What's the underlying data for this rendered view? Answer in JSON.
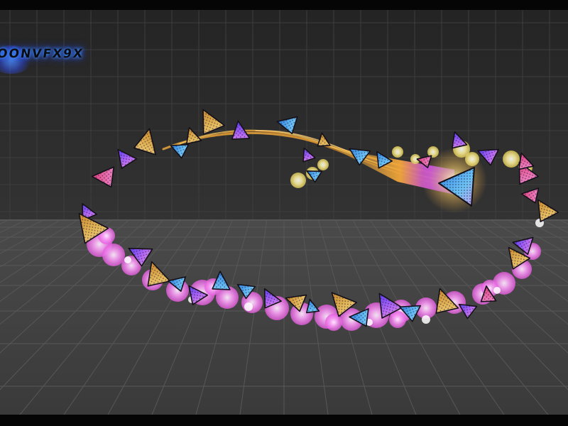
{
  "watermark": {
    "text": "OONVFX9X"
  },
  "colors": {
    "wall": "#2d2d2d",
    "wall_grid": "#3c3c3c",
    "floor": "#444444",
    "floor_grid": "#5a5a5a",
    "smoke_pink": "#f37ff0",
    "smoke_yellow": "#f3e07a",
    "smoke_white": "#fff1ff",
    "triangle_violet": "#9b5bf0",
    "triangle_blue": "#4aa6ec",
    "triangle_gold": "#d8a23c",
    "triangle_pink": "#f06ab8",
    "trail_gold": "#f0b040",
    "trail_violet": "#a855f7",
    "glow": "#ffe9a0",
    "logo_glow": "#3f8cff"
  },
  "scene": {
    "description_items": [
      "grid-wall",
      "grid-floor",
      "vfx-trail-loop",
      "triangle-particles",
      "smoke-puffs",
      "leading-glow"
    ]
  }
}
